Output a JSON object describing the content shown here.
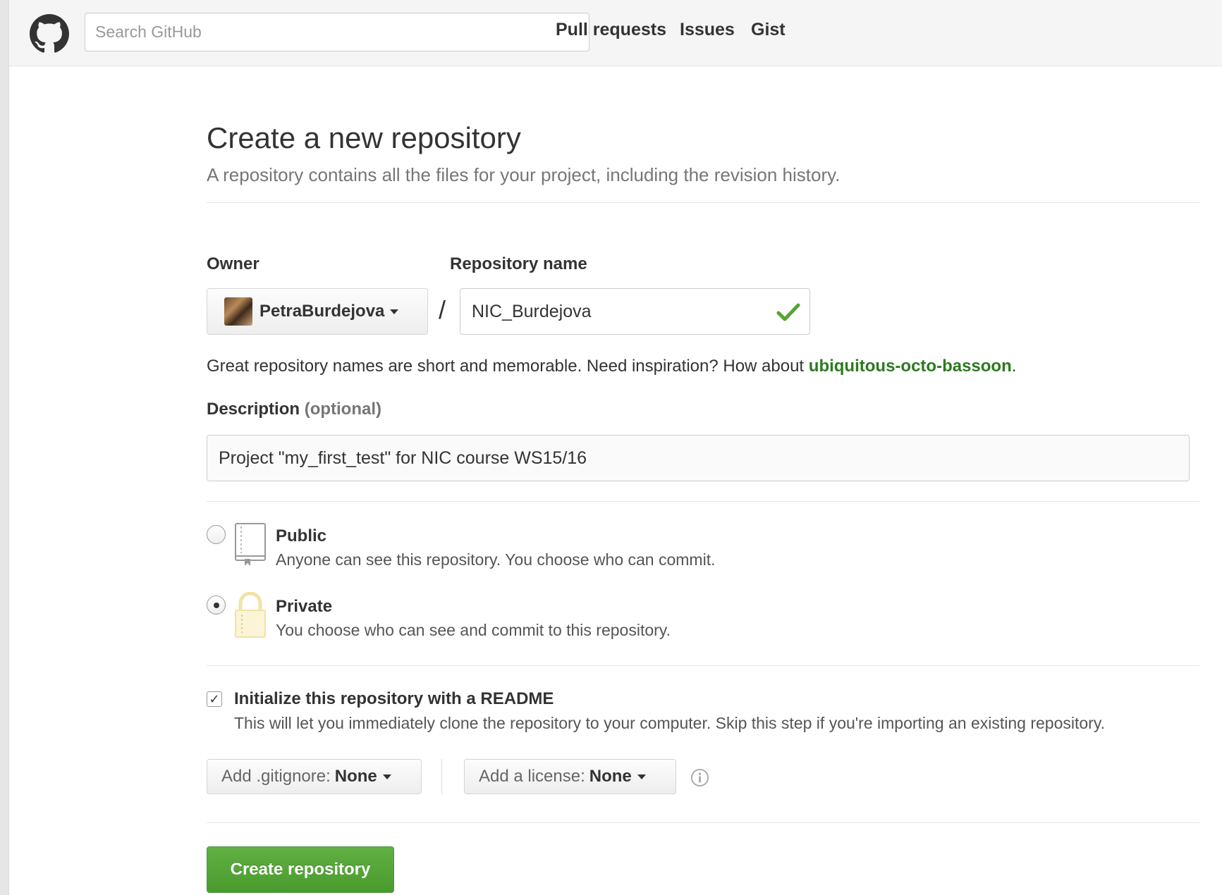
{
  "header": {
    "search_placeholder": "Search GitHub",
    "nav": [
      "Pull requests",
      "Issues",
      "Gist"
    ]
  },
  "page": {
    "title": "Create a new repository",
    "subtitle": "A repository contains all the files for your project, including the revision history."
  },
  "form": {
    "owner_label": "Owner",
    "owner_value": "PetraBurdejova",
    "repo_label": "Repository name",
    "separator": "/",
    "repo_value": "NIC_Burdejova",
    "hint_text": "Great repository names are short and memorable. Need inspiration? How about ",
    "hint_suggestion": "ubiquitous-octo-bassoon",
    "hint_end": ".",
    "description_label": "Description",
    "description_optional": "(optional)",
    "description_value": "Project \"my_first_test\" for NIC course WS15/16",
    "visibility": {
      "selected": "Private",
      "public_title": "Public",
      "public_desc": "Anyone can see this repository. You choose who can commit.",
      "private_title": "Private",
      "private_desc": "You choose who can see and commit to this repository."
    },
    "readme": {
      "checked": true,
      "checkmark": "✓",
      "title": "Initialize this repository with a README",
      "desc": "This will let you immediately clone the repository to your computer. Skip this step if you're importing an existing repository."
    },
    "gitignore_label": "Add .gitignore:",
    "gitignore_value": "None",
    "license_label": "Add a license:",
    "license_value": "None",
    "submit_label": "Create repository"
  },
  "colors": {
    "accent_green": "#55a532",
    "link_green": "#2c7a1f",
    "lock_yellow": "#f1e3a6"
  }
}
